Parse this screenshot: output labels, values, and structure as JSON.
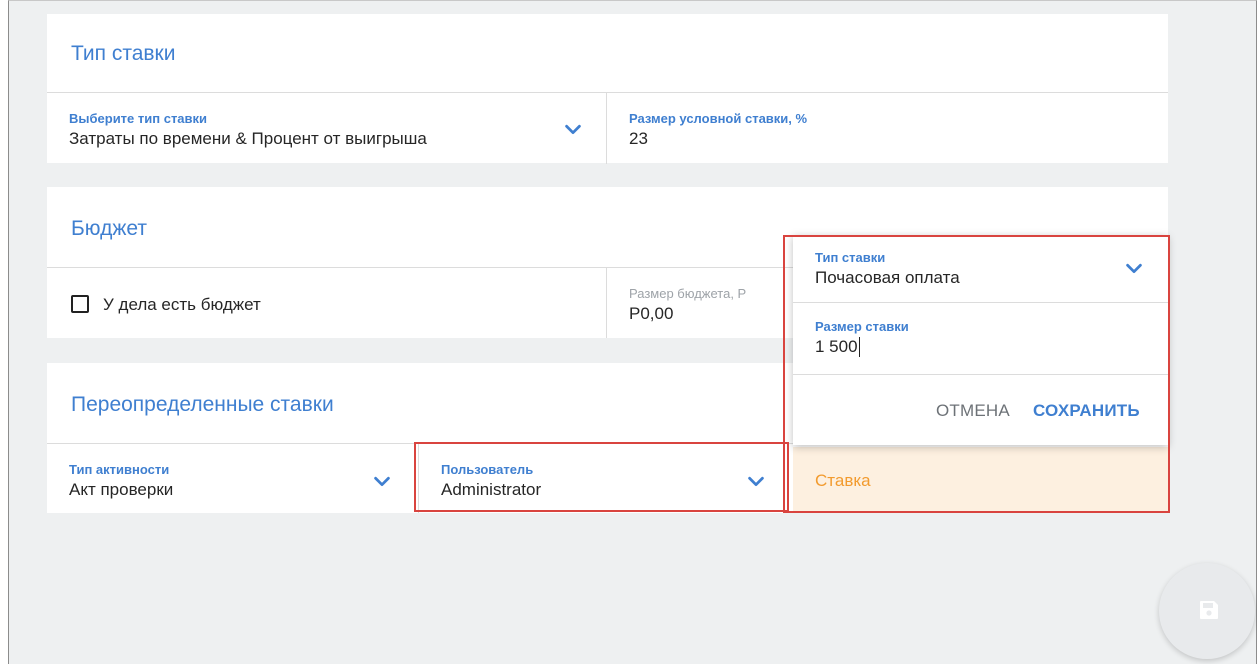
{
  "rate_type_section": {
    "title": "Тип ставки",
    "select_label": "Выберите тип ставки",
    "select_value": "Затраты по времени & Процент от выигрыша",
    "conditional_label": "Размер условной ставки, %",
    "conditional_value": "23"
  },
  "budget_section": {
    "title": "Бюджет",
    "checkbox_label": "У дела есть бюджет",
    "checkbox_checked": false,
    "amount_label": "Размер бюджета, Р",
    "amount_value": "Р0,00"
  },
  "override_section": {
    "title": "Переопределенные ставки",
    "activity_label": "Тип активности",
    "activity_value": "Акт проверки",
    "user_label": "Пользователь",
    "user_value": "Administrator",
    "rate_placeholder": "Ставка"
  },
  "popup": {
    "type_label": "Тип ставки",
    "type_value": "Почасовая оплата",
    "amount_label": "Размер ставки",
    "amount_value": "1 500",
    "cancel_label": "ОТМЕНА",
    "save_label": "СОХРАНИТЬ"
  },
  "icons": {
    "chevron": "chevron-down-icon",
    "save_fab": "floppy-disk-icon"
  },
  "colors": {
    "accent": "#3f7fd0",
    "highlight": "#d9443f",
    "rate_bg": "#fdf0e0",
    "rate_text": "#f29b2f"
  }
}
